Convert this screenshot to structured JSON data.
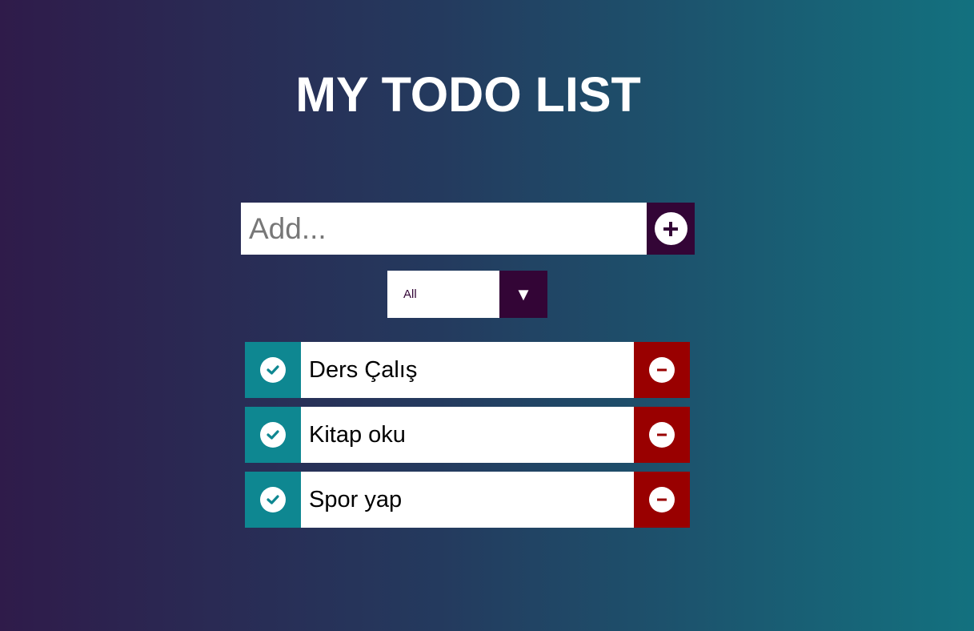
{
  "header": {
    "title": "MY TODO LIST"
  },
  "add_form": {
    "placeholder": "Add...",
    "value": "",
    "add_icon": "plus-circle-icon"
  },
  "filter": {
    "selected": "All",
    "arrow": "▼"
  },
  "todos": [
    {
      "text": "Ders Çalış"
    },
    {
      "text": "Kitap oku"
    },
    {
      "text": "Spor yap"
    }
  ],
  "icons": {
    "check": "check-circle-icon",
    "remove": "minus-circle-icon"
  },
  "colors": {
    "gradient_start": "#2f1b4a",
    "gradient_end": "#13717f",
    "accent_dark": "#330536",
    "check_bg": "#0e8791",
    "remove_bg": "#990000"
  }
}
